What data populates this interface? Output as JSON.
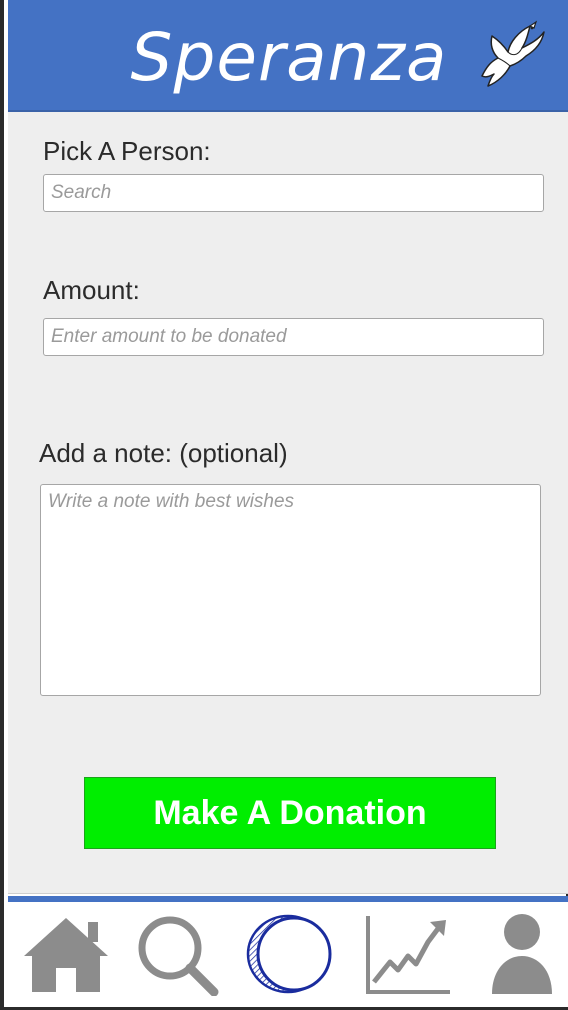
{
  "header": {
    "app_title": "Speranza",
    "logo_icon": "dove-icon",
    "color": "#4472c4"
  },
  "form": {
    "person": {
      "label": "Pick A Person:",
      "placeholder": "Search",
      "value": ""
    },
    "amount": {
      "label": "Amount:",
      "placeholder": "Enter amount to be donated",
      "value": ""
    },
    "note": {
      "label": "Add a note: (optional)",
      "placeholder": "Write a note with best wishes",
      "value": ""
    }
  },
  "donate_button": {
    "label": "Make A Donation",
    "color": "#00ee00"
  },
  "tabbar": {
    "active": "donate",
    "items": [
      {
        "id": "home",
        "icon": "home-icon"
      },
      {
        "id": "search",
        "icon": "search-icon"
      },
      {
        "id": "donate",
        "icon": "coin-icon"
      },
      {
        "id": "stats",
        "icon": "chart-icon"
      },
      {
        "id": "profile",
        "icon": "user-icon"
      }
    ],
    "active_color": "#1a2c9e",
    "inactive_color": "#8c8c8c"
  }
}
